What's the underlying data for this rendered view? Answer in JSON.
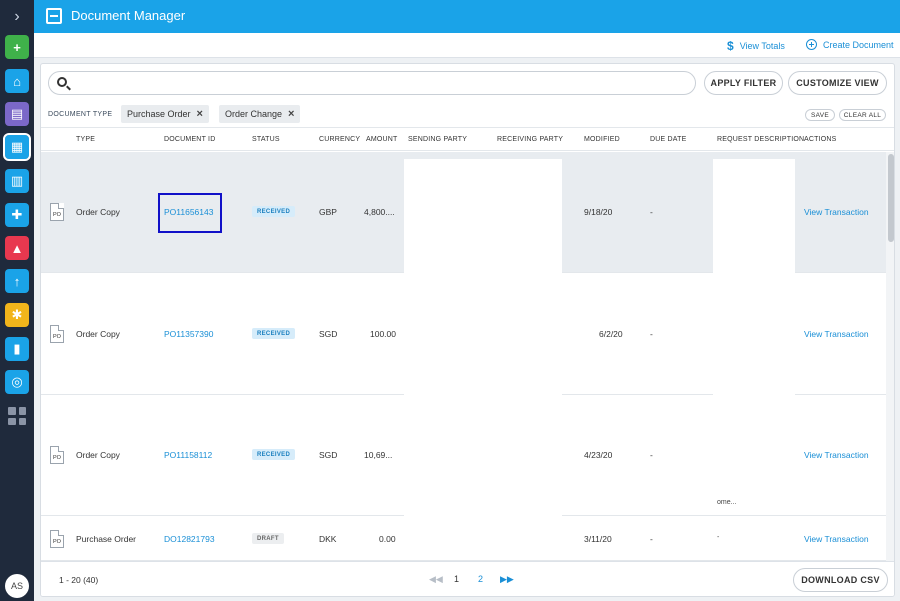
{
  "header": {
    "title": "Document Manager"
  },
  "subbar": {
    "view_totals": "View Totals",
    "create_document": "Create Document"
  },
  "rail": {
    "avatar": "AS",
    "items": [
      {
        "icon": "add-icon",
        "color": "#3fb14a",
        "glyph": "+"
      },
      {
        "icon": "home-icon",
        "color": "#1aa3e8",
        "glyph": "⌂"
      },
      {
        "icon": "messages-icon",
        "color": "#7b68c8",
        "glyph": "▤"
      },
      {
        "icon": "document-manager-icon",
        "color": "#1aa3e8",
        "glyph": "▦"
      },
      {
        "icon": "clipboard-icon",
        "color": "#1aa3e8",
        "glyph": "▥"
      },
      {
        "icon": "support-icon",
        "color": "#1aa3e8",
        "glyph": "✚"
      },
      {
        "icon": "learning-icon",
        "color": "#e8384f",
        "glyph": "▲"
      },
      {
        "icon": "upload-icon",
        "color": "#1aa3e8",
        "glyph": "↑"
      },
      {
        "icon": "integrations-icon",
        "color": "#f2b51b",
        "glyph": "✱"
      },
      {
        "icon": "buildings-icon",
        "color": "#1aa3e8",
        "glyph": "▮"
      },
      {
        "icon": "network-icon",
        "color": "#1aa3e8",
        "glyph": "◎"
      }
    ]
  },
  "toolbar": {
    "search_placeholder": "",
    "apply_filter": "APPLY FILTER",
    "customize_view": "CUSTOMIZE VIEW"
  },
  "filters": {
    "label": "DOCUMENT TYPE",
    "chips": [
      "Purchase Order",
      "Order Change"
    ],
    "save": "SAVE",
    "clear_all": "CLEAR ALL"
  },
  "columns": [
    "TYPE",
    "DOCUMENT ID",
    "STATUS",
    "CURRENCY",
    "AMOUNT",
    "SENDING PARTY",
    "RECEIVING PARTY",
    "MODIFIED",
    "DUE DATE",
    "REQUEST DESCRIPTION",
    "ACTIONS"
  ],
  "rows": [
    {
      "icon_label": "PO",
      "type": "Order Copy",
      "doc_id": "PO11656143",
      "status": "RECEIVED",
      "currency": "GBP",
      "amount": "4,800....",
      "modified": "9/18/20",
      "due": "-",
      "action": "View Transaction"
    },
    {
      "icon_label": "PO",
      "type": "Order Copy",
      "doc_id": "PO11357390",
      "status": "RECEIVED",
      "currency": "SGD",
      "amount": "100.00",
      "modified": "6/2/20",
      "due": "-",
      "action": "View Transaction"
    },
    {
      "icon_label": "PO",
      "type": "Order Copy",
      "doc_id": "PO11158112",
      "status": "RECEIVED",
      "currency": "SGD",
      "amount": "10,69...",
      "modified": "4/23/20",
      "due": "-",
      "action": "View Transaction"
    },
    {
      "icon_label": "PO",
      "type": "Purchase Order",
      "doc_id": "DO12821793",
      "status": "DRAFT",
      "currency": "DKK",
      "amount": "0.00",
      "modified": "3/11/20",
      "due": "-",
      "action": "View Transaction"
    }
  ],
  "fragments": {
    "ome": "ome...",
    "dash": "-"
  },
  "footer": {
    "range": "1 - 20 (40)",
    "page1": "1",
    "page2": "2",
    "download": "DOWNLOAD CSV"
  }
}
